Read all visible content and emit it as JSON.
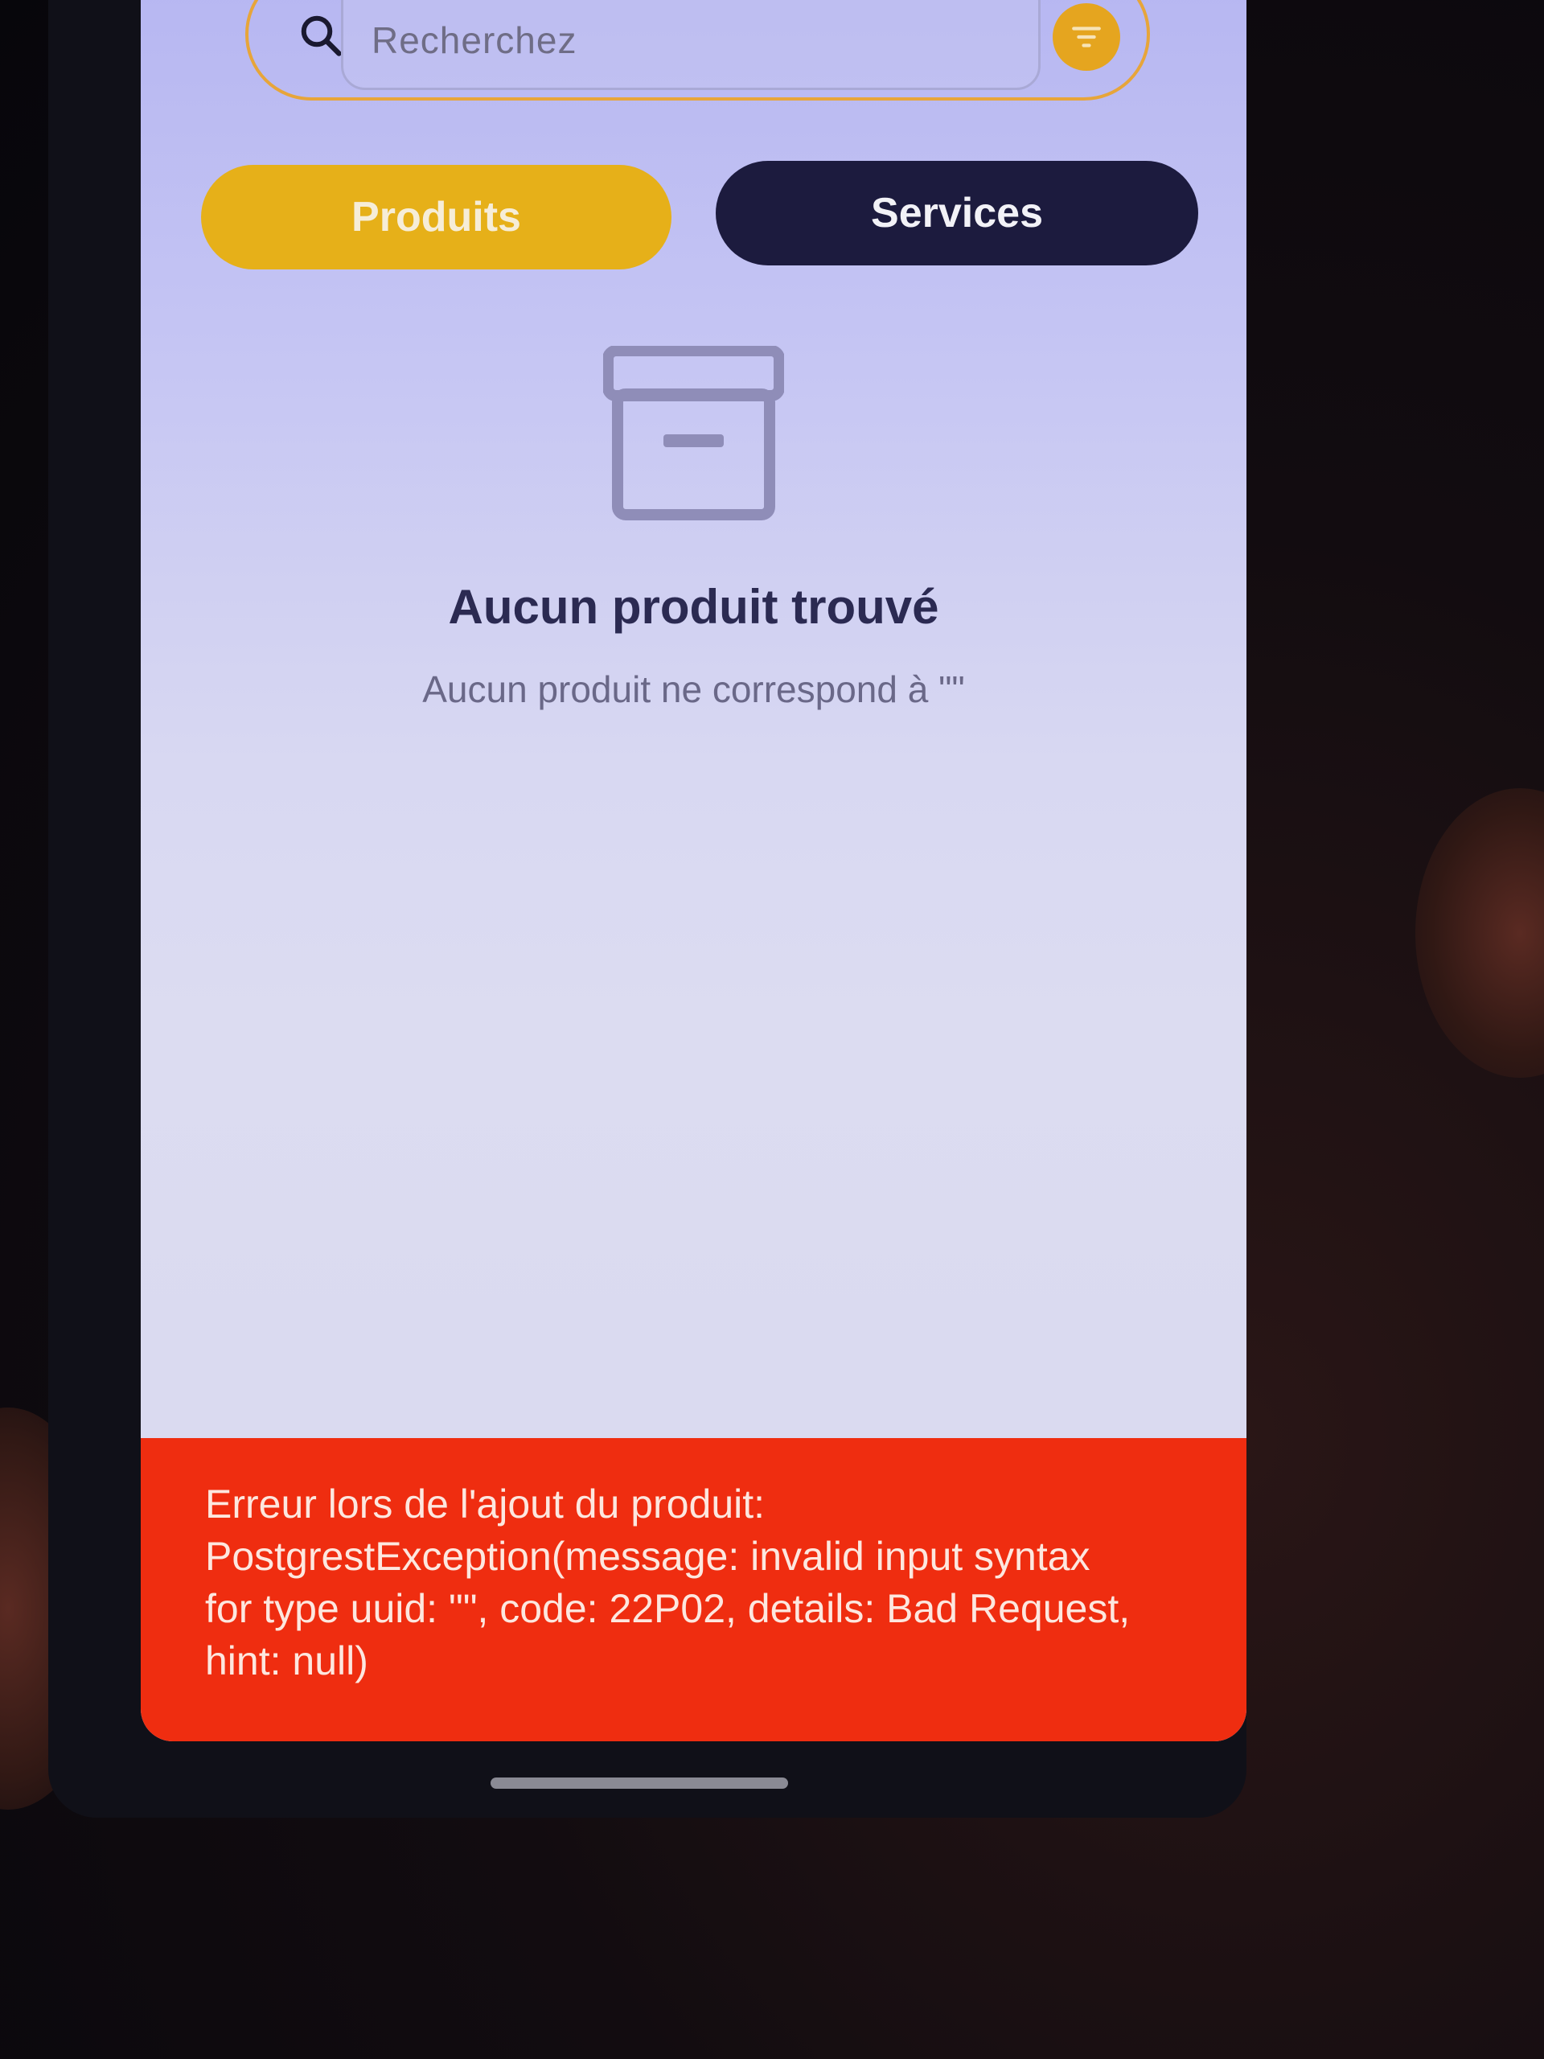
{
  "search": {
    "placeholder": "Recherchez",
    "icon": "search-icon",
    "filter_icon": "filter-icon"
  },
  "tabs": [
    {
      "label": "Produits",
      "active": true,
      "color": "#e6b019"
    },
    {
      "label": "Services",
      "active": false,
      "color": "#1c1b3e"
    }
  ],
  "empty_state": {
    "icon": "archive-box-icon",
    "title": "Aucun produit trouvé",
    "subtitle": "Aucun produit ne correspond à \"\""
  },
  "error": {
    "message": "Erreur lors de l'ajout du produit:\nPostgrestException(message: invalid input syntax\nfor type uuid: \"\", code: 22P02, details: Bad Request,\nhint: null)",
    "color": "#ef2d10"
  },
  "colors": {
    "accent": "#e5a51f",
    "dark": "#1c1b3e"
  }
}
